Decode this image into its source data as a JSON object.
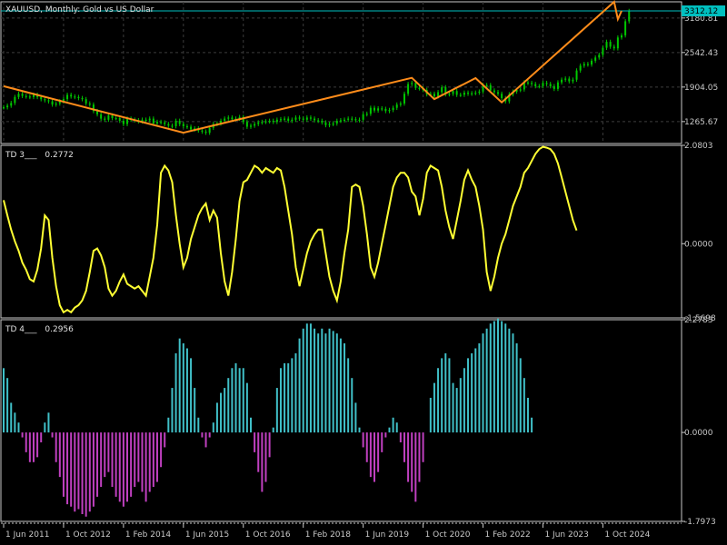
{
  "window": {
    "symbol_title": "XAUUSD, Monthly:  Gold vs US Dollar"
  },
  "colors": {
    "background": "#000000",
    "grid": "#3c3c3c",
    "axis": "#c8c8c8",
    "bull_candle": "#00c800",
    "bear_candle": "#00c800",
    "zigzag": "#ff8c1a",
    "price_line": "#00bfbf",
    "price_badge": "#00bfbf",
    "td3_line": "#ffff33",
    "td4_pos": "#40c0c8",
    "td4_neg": "#c040c0"
  },
  "price_badge": "3312.12",
  "chart_data": [
    {
      "type": "line",
      "title": "XAUUSD, Monthly:  Gold vs US Dollar",
      "y_ticks": [
        "3180.81",
        "2542.43",
        "1904.05",
        "1265.67"
      ],
      "y_tick_values": [
        3180.81,
        2542.43,
        1904.05,
        1265.67
      ],
      "ylim": [
        860,
        3480
      ],
      "current_price": 3312.12,
      "x_ticks": [
        "1 Jun 2011",
        "1 Oct 2012",
        "1 Feb 2014",
        "1 Jun 2015",
        "1 Oct 2016",
        "1 Feb 2018",
        "1 Jun 2019",
        "1 Oct 2020",
        "1 Feb 2022",
        "1 Jun 2023",
        "1 Oct 2024"
      ],
      "x_tick_index": [
        0,
        16,
        32,
        48,
        64,
        80,
        96,
        112,
        128,
        144,
        160
      ],
      "price_series": [
        1530,
        1560,
        1610,
        1720,
        1780,
        1740,
        1730,
        1720,
        1760,
        1720,
        1680,
        1660,
        1640,
        1580,
        1600,
        1640,
        1680,
        1760,
        1730,
        1720,
        1700,
        1680,
        1600,
        1580,
        1460,
        1400,
        1320,
        1300,
        1380,
        1330,
        1330,
        1280,
        1220,
        1320,
        1300,
        1290,
        1270,
        1300,
        1290,
        1320,
        1230,
        1260,
        1250,
        1220,
        1190,
        1180,
        1280,
        1220,
        1180,
        1170,
        1120,
        1140,
        1100,
        1080,
        1060,
        1150,
        1220,
        1230,
        1280,
        1320,
        1340,
        1310,
        1320,
        1350,
        1260,
        1170,
        1190,
        1220,
        1250,
        1260,
        1270,
        1280,
        1260,
        1300,
        1310,
        1320,
        1280,
        1300,
        1340,
        1320,
        1300,
        1340,
        1320,
        1290,
        1280,
        1250,
        1200,
        1220,
        1230,
        1280,
        1290,
        1300,
        1320,
        1310,
        1290,
        1300,
        1400,
        1410,
        1520,
        1470,
        1510,
        1500,
        1460,
        1480,
        1520,
        1580,
        1600,
        1780,
        1960,
        1980,
        1890,
        1880,
        1850,
        1770,
        1780,
        1730,
        1810,
        1900,
        1770,
        1780,
        1830,
        1760,
        1760,
        1800,
        1780,
        1790,
        1800,
        1820,
        1940,
        1940,
        1840,
        1810,
        1780,
        1700,
        1640,
        1770,
        1820,
        1850,
        1860,
        1990,
        1980,
        1960,
        1920,
        1920,
        1980,
        1960,
        1920,
        1870,
        1990,
        2040,
        2060,
        2010,
        2040,
        2210,
        2300,
        2330,
        2320,
        2390,
        2450,
        2500,
        2630,
        2740,
        2650,
        2620,
        2820,
        2860,
        3120,
        3310
      ],
      "zigzag_points": [
        [
          0,
          1920
        ],
        [
          48,
          1060
        ],
        [
          109,
          2075
        ],
        [
          115,
          1680
        ],
        [
          126,
          2070
        ],
        [
          133,
          1620
        ],
        [
          163,
          3480
        ],
        [
          164,
          3160
        ],
        [
          165,
          3312
        ]
      ]
    },
    {
      "type": "line",
      "title": "TD 3___  0.2772",
      "indicator_label": "TD 3___",
      "indicator_value": "0.2772",
      "y_ticks": [
        "2.0803",
        "0.0000",
        "-1.5698"
      ],
      "y_tick_values": [
        2.0803,
        0.0,
        -1.5698
      ],
      "ylim": [
        -1.5698,
        2.0803
      ],
      "series": [
        {
          "values": [
            0.92,
            0.6,
            0.3,
            0.05,
            -0.15,
            -0.4,
            -0.55,
            -0.75,
            -0.8,
            -0.55,
            -0.1,
            0.6,
            0.5,
            -0.3,
            -0.9,
            -1.3,
            -1.45,
            -1.4,
            -1.45,
            -1.35,
            -1.3,
            -1.2,
            -1.0,
            -0.6,
            -0.15,
            -0.1,
            -0.25,
            -0.5,
            -0.95,
            -1.1,
            -1.0,
            -0.8,
            -0.65,
            -0.85,
            -0.9,
            -0.95,
            -0.9,
            -1.0,
            -1.1,
            -0.7,
            -0.3,
            0.4,
            1.5,
            1.65,
            1.55,
            1.3,
            0.6,
            0.0,
            -0.5,
            -0.3,
            0.1,
            0.35,
            0.6,
            0.75,
            0.85,
            0.5,
            0.7,
            0.55,
            -0.2,
            -0.8,
            -1.1,
            -0.6,
            0.1,
            0.9,
            1.3,
            1.35,
            1.5,
            1.65,
            1.6,
            1.5,
            1.6,
            1.55,
            1.5,
            1.6,
            1.55,
            1.2,
            0.7,
            0.2,
            -0.5,
            -0.9,
            -0.55,
            -0.2,
            0.05,
            0.2,
            0.3,
            0.3,
            -0.2,
            -0.7,
            -1.0,
            -1.2,
            -0.8,
            -0.2,
            0.3,
            1.2,
            1.25,
            1.2,
            0.8,
            0.2,
            -0.5,
            -0.7,
            -0.4,
            0.0,
            0.4,
            0.8,
            1.2,
            1.4,
            1.5,
            1.5,
            1.4,
            1.1,
            1.0,
            0.6,
            0.95,
            1.5,
            1.65,
            1.6,
            1.55,
            1.2,
            0.7,
            0.35,
            0.1,
            0.5,
            0.9,
            1.35,
            1.55,
            1.35,
            1.2,
            0.8,
            0.3,
            -0.6,
            -1.0,
            -0.7,
            -0.3,
            0.0,
            0.2,
            0.5,
            0.8,
            1.0,
            1.2,
            1.5,
            1.6,
            1.75,
            1.9,
            2.0,
            2.05,
            2.03,
            2.0,
            1.9,
            1.7,
            1.4,
            1.1,
            0.8,
            0.5,
            0.28
          ],
          "color": "#ffff33"
        }
      ]
    },
    {
      "type": "bar",
      "title": "TD 4___  0.2956",
      "indicator_label": "TD 4___",
      "indicator_value": "0.2956",
      "y_ticks": [
        "2.2783",
        "0.0000",
        "-1.7973"
      ],
      "y_tick_values": [
        2.2783,
        0.0,
        -1.7973
      ],
      "ylim": [
        -1.7973,
        2.2783
      ],
      "series": [
        {
          "values": [
            1.3,
            1.1,
            0.6,
            0.4,
            0.2,
            -0.1,
            -0.4,
            -0.6,
            -0.6,
            -0.5,
            -0.2,
            0.2,
            0.4,
            -0.1,
            -0.6,
            -0.9,
            -1.3,
            -1.45,
            -1.5,
            -1.6,
            -1.55,
            -1.65,
            -1.7,
            -1.6,
            -1.5,
            -1.3,
            -1.1,
            -0.9,
            -0.8,
            -1.1,
            -1.3,
            -1.4,
            -1.5,
            -1.4,
            -1.3,
            -1.1,
            -1.0,
            -1.2,
            -1.4,
            -1.2,
            -1.1,
            -1.0,
            -0.7,
            -0.3,
            0.3,
            0.9,
            1.6,
            1.9,
            1.8,
            1.7,
            1.5,
            0.9,
            0.3,
            -0.1,
            -0.3,
            -0.1,
            0.2,
            0.6,
            0.8,
            0.9,
            1.1,
            1.3,
            1.4,
            1.3,
            1.3,
            1.0,
            0.3,
            -0.4,
            -0.8,
            -1.2,
            -1.0,
            -0.5,
            0.1,
            0.9,
            1.3,
            1.4,
            1.4,
            1.5,
            1.6,
            1.9,
            2.1,
            2.2,
            2.2,
            2.1,
            2.0,
            2.1,
            2.0,
            2.1,
            2.05,
            2.0,
            1.9,
            1.8,
            1.5,
            1.1,
            0.6,
            0.1,
            -0.3,
            -0.6,
            -0.9,
            -1.0,
            -0.8,
            -0.4,
            -0.1,
            0.1,
            0.3,
            0.2,
            -0.2,
            -0.6,
            -1.0,
            -1.2,
            -1.4,
            -1.0,
            -0.6,
            0.0,
            0.7,
            1.0,
            1.3,
            1.5,
            1.6,
            1.5,
            1.0,
            0.9,
            1.1,
            1.3,
            1.5,
            1.6,
            1.7,
            1.8,
            2.0,
            2.1,
            2.2,
            2.25,
            2.3,
            2.25,
            2.2,
            2.1,
            2.0,
            1.8,
            1.5,
            1.1,
            0.7,
            0.3
          ],
          "pos_color": "#40c0c8",
          "neg_color": "#c040c0"
        }
      ]
    }
  ]
}
